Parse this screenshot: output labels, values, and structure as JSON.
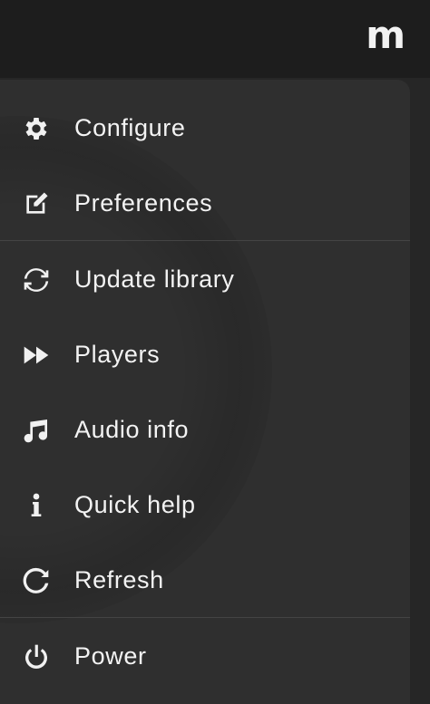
{
  "app": {
    "logo_text": "m"
  },
  "menu": {
    "items": [
      {
        "label": "Configure",
        "icon": "gear-icon"
      },
      {
        "label": "Preferences",
        "icon": "edit-icon"
      },
      {
        "label": "Update library",
        "icon": "sync-icon"
      },
      {
        "label": "Players",
        "icon": "fast-forward-icon"
      },
      {
        "label": "Audio info",
        "icon": "music-note-icon"
      },
      {
        "label": "Quick help",
        "icon": "info-icon"
      },
      {
        "label": "Refresh",
        "icon": "refresh-icon"
      },
      {
        "label": "Power",
        "icon": "power-icon"
      }
    ]
  },
  "colors": {
    "background": "#262626",
    "topbar": "#1d1d1d",
    "menu_background": "#2f2f2f",
    "text": "#f3f3f3",
    "divider": "#444444"
  }
}
